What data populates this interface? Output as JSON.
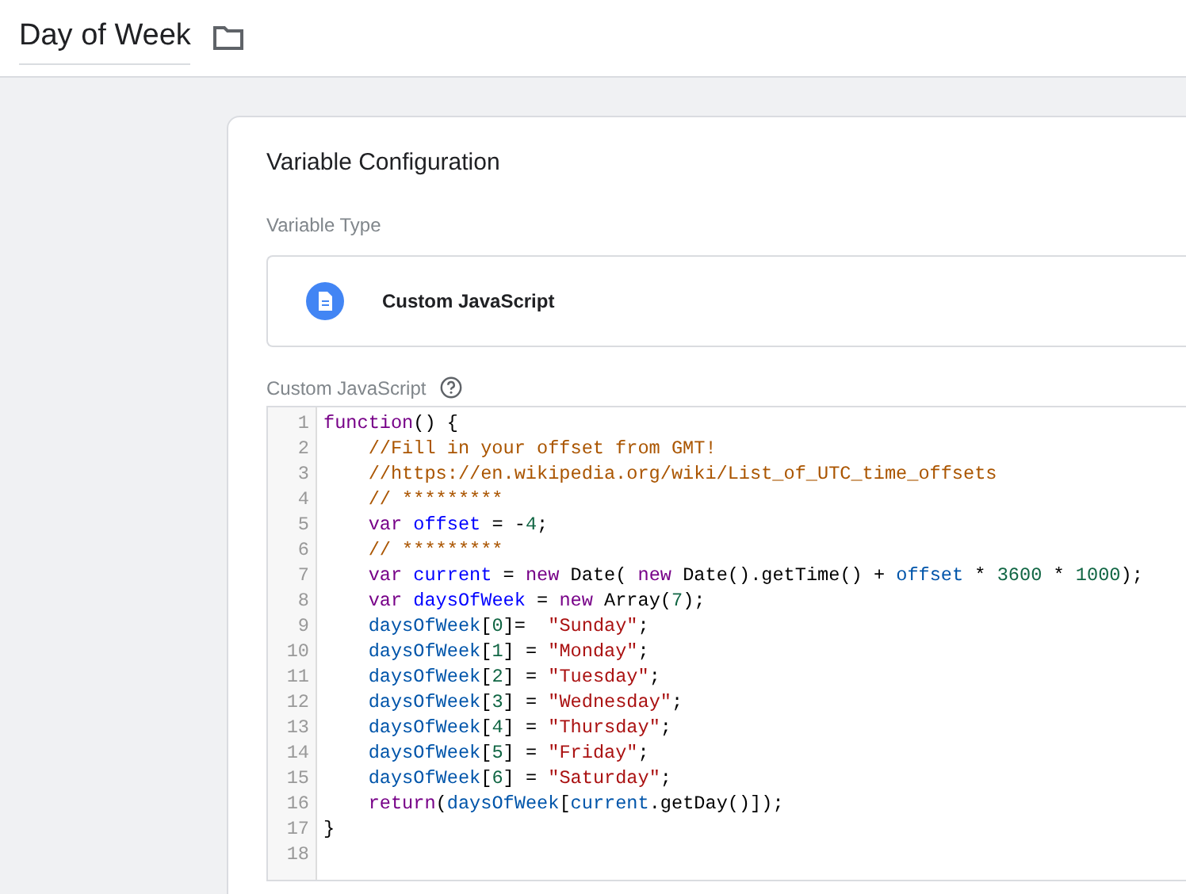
{
  "header": {
    "title": "Day of Week"
  },
  "card": {
    "title": "Variable Configuration",
    "type_label": "Variable Type",
    "type_value": "Custom JavaScript",
    "editor_label": "Custom JavaScript"
  },
  "code_lines": [
    {
      "number": "1",
      "indented": false,
      "tokens": [
        {
          "kind": "keyword",
          "text": "function"
        },
        {
          "kind": "plain",
          "text": "() {"
        }
      ]
    },
    {
      "number": "2",
      "indented": true,
      "tokens": [
        {
          "kind": "comment",
          "text": "//Fill in your offset from GMT!"
        }
      ]
    },
    {
      "number": "3",
      "indented": true,
      "tokens": [
        {
          "kind": "comment",
          "text": "//https://en.wikipedia.org/wiki/List_of_UTC_time_offsets"
        }
      ]
    },
    {
      "number": "4",
      "indented": true,
      "tokens": [
        {
          "kind": "comment",
          "text": "// *********"
        }
      ]
    },
    {
      "number": "5",
      "indented": true,
      "tokens": [
        {
          "kind": "keyword",
          "text": "var"
        },
        {
          "kind": "def",
          "text": " offset"
        },
        {
          "kind": "plain",
          "text": " = -"
        },
        {
          "kind": "number",
          "text": "4"
        },
        {
          "kind": "plain",
          "text": ";"
        }
      ]
    },
    {
      "number": "6",
      "indented": true,
      "tokens": [
        {
          "kind": "comment",
          "text": "// *********"
        }
      ]
    },
    {
      "number": "7",
      "indented": true,
      "tokens": [
        {
          "kind": "keyword",
          "text": "var"
        },
        {
          "kind": "def",
          "text": " current"
        },
        {
          "kind": "plain",
          "text": " = "
        },
        {
          "kind": "keyword",
          "text": "new"
        },
        {
          "kind": "plain",
          "text": " Date( "
        },
        {
          "kind": "keyword",
          "text": "new"
        },
        {
          "kind": "plain",
          "text": " Date().getTime() + "
        },
        {
          "kind": "variable",
          "text": "offset"
        },
        {
          "kind": "plain",
          "text": " * "
        },
        {
          "kind": "number",
          "text": "3600"
        },
        {
          "kind": "plain",
          "text": " * "
        },
        {
          "kind": "number",
          "text": "1000"
        },
        {
          "kind": "plain",
          "text": ");"
        }
      ]
    },
    {
      "number": "8",
      "indented": true,
      "tokens": [
        {
          "kind": "keyword",
          "text": "var"
        },
        {
          "kind": "def",
          "text": " daysOfWeek"
        },
        {
          "kind": "plain",
          "text": " = "
        },
        {
          "kind": "keyword",
          "text": "new"
        },
        {
          "kind": "plain",
          "text": " Array("
        },
        {
          "kind": "number",
          "text": "7"
        },
        {
          "kind": "plain",
          "text": ");"
        }
      ]
    },
    {
      "number": "9",
      "indented": true,
      "tokens": [
        {
          "kind": "variable",
          "text": "daysOfWeek"
        },
        {
          "kind": "plain",
          "text": "["
        },
        {
          "kind": "number",
          "text": "0"
        },
        {
          "kind": "plain",
          "text": "]=  "
        },
        {
          "kind": "string",
          "text": "\"Sunday\""
        },
        {
          "kind": "plain",
          "text": ";"
        }
      ]
    },
    {
      "number": "10",
      "indented": true,
      "tokens": [
        {
          "kind": "variable",
          "text": "daysOfWeek"
        },
        {
          "kind": "plain",
          "text": "["
        },
        {
          "kind": "number",
          "text": "1"
        },
        {
          "kind": "plain",
          "text": "] = "
        },
        {
          "kind": "string",
          "text": "\"Monday\""
        },
        {
          "kind": "plain",
          "text": ";"
        }
      ]
    },
    {
      "number": "11",
      "indented": true,
      "tokens": [
        {
          "kind": "variable",
          "text": "daysOfWeek"
        },
        {
          "kind": "plain",
          "text": "["
        },
        {
          "kind": "number",
          "text": "2"
        },
        {
          "kind": "plain",
          "text": "] = "
        },
        {
          "kind": "string",
          "text": "\"Tuesday\""
        },
        {
          "kind": "plain",
          "text": ";"
        }
      ]
    },
    {
      "number": "12",
      "indented": true,
      "tokens": [
        {
          "kind": "variable",
          "text": "daysOfWeek"
        },
        {
          "kind": "plain",
          "text": "["
        },
        {
          "kind": "number",
          "text": "3"
        },
        {
          "kind": "plain",
          "text": "] = "
        },
        {
          "kind": "string",
          "text": "\"Wednesday\""
        },
        {
          "kind": "plain",
          "text": ";"
        }
      ]
    },
    {
      "number": "13",
      "indented": true,
      "tokens": [
        {
          "kind": "variable",
          "text": "daysOfWeek"
        },
        {
          "kind": "plain",
          "text": "["
        },
        {
          "kind": "number",
          "text": "4"
        },
        {
          "kind": "plain",
          "text": "] = "
        },
        {
          "kind": "string",
          "text": "\"Thursday\""
        },
        {
          "kind": "plain",
          "text": ";"
        }
      ]
    },
    {
      "number": "14",
      "indented": true,
      "tokens": [
        {
          "kind": "variable",
          "text": "daysOfWeek"
        },
        {
          "kind": "plain",
          "text": "["
        },
        {
          "kind": "number",
          "text": "5"
        },
        {
          "kind": "plain",
          "text": "] = "
        },
        {
          "kind": "string",
          "text": "\"Friday\""
        },
        {
          "kind": "plain",
          "text": ";"
        }
      ]
    },
    {
      "number": "15",
      "indented": true,
      "tokens": [
        {
          "kind": "variable",
          "text": "daysOfWeek"
        },
        {
          "kind": "plain",
          "text": "["
        },
        {
          "kind": "number",
          "text": "6"
        },
        {
          "kind": "plain",
          "text": "] = "
        },
        {
          "kind": "string",
          "text": "\"Saturday\""
        },
        {
          "kind": "plain",
          "text": ";"
        }
      ]
    },
    {
      "number": "16",
      "indented": true,
      "tokens": [
        {
          "kind": "keyword",
          "text": "return"
        },
        {
          "kind": "plain",
          "text": "("
        },
        {
          "kind": "variable",
          "text": "daysOfWeek"
        },
        {
          "kind": "plain",
          "text": "["
        },
        {
          "kind": "variable",
          "text": "current"
        },
        {
          "kind": "plain",
          "text": ".getDay()]);"
        }
      ]
    },
    {
      "number": "17",
      "indented": false,
      "tokens": [
        {
          "kind": "plain",
          "text": "}"
        }
      ]
    },
    {
      "number": "18"
    }
  ]
}
